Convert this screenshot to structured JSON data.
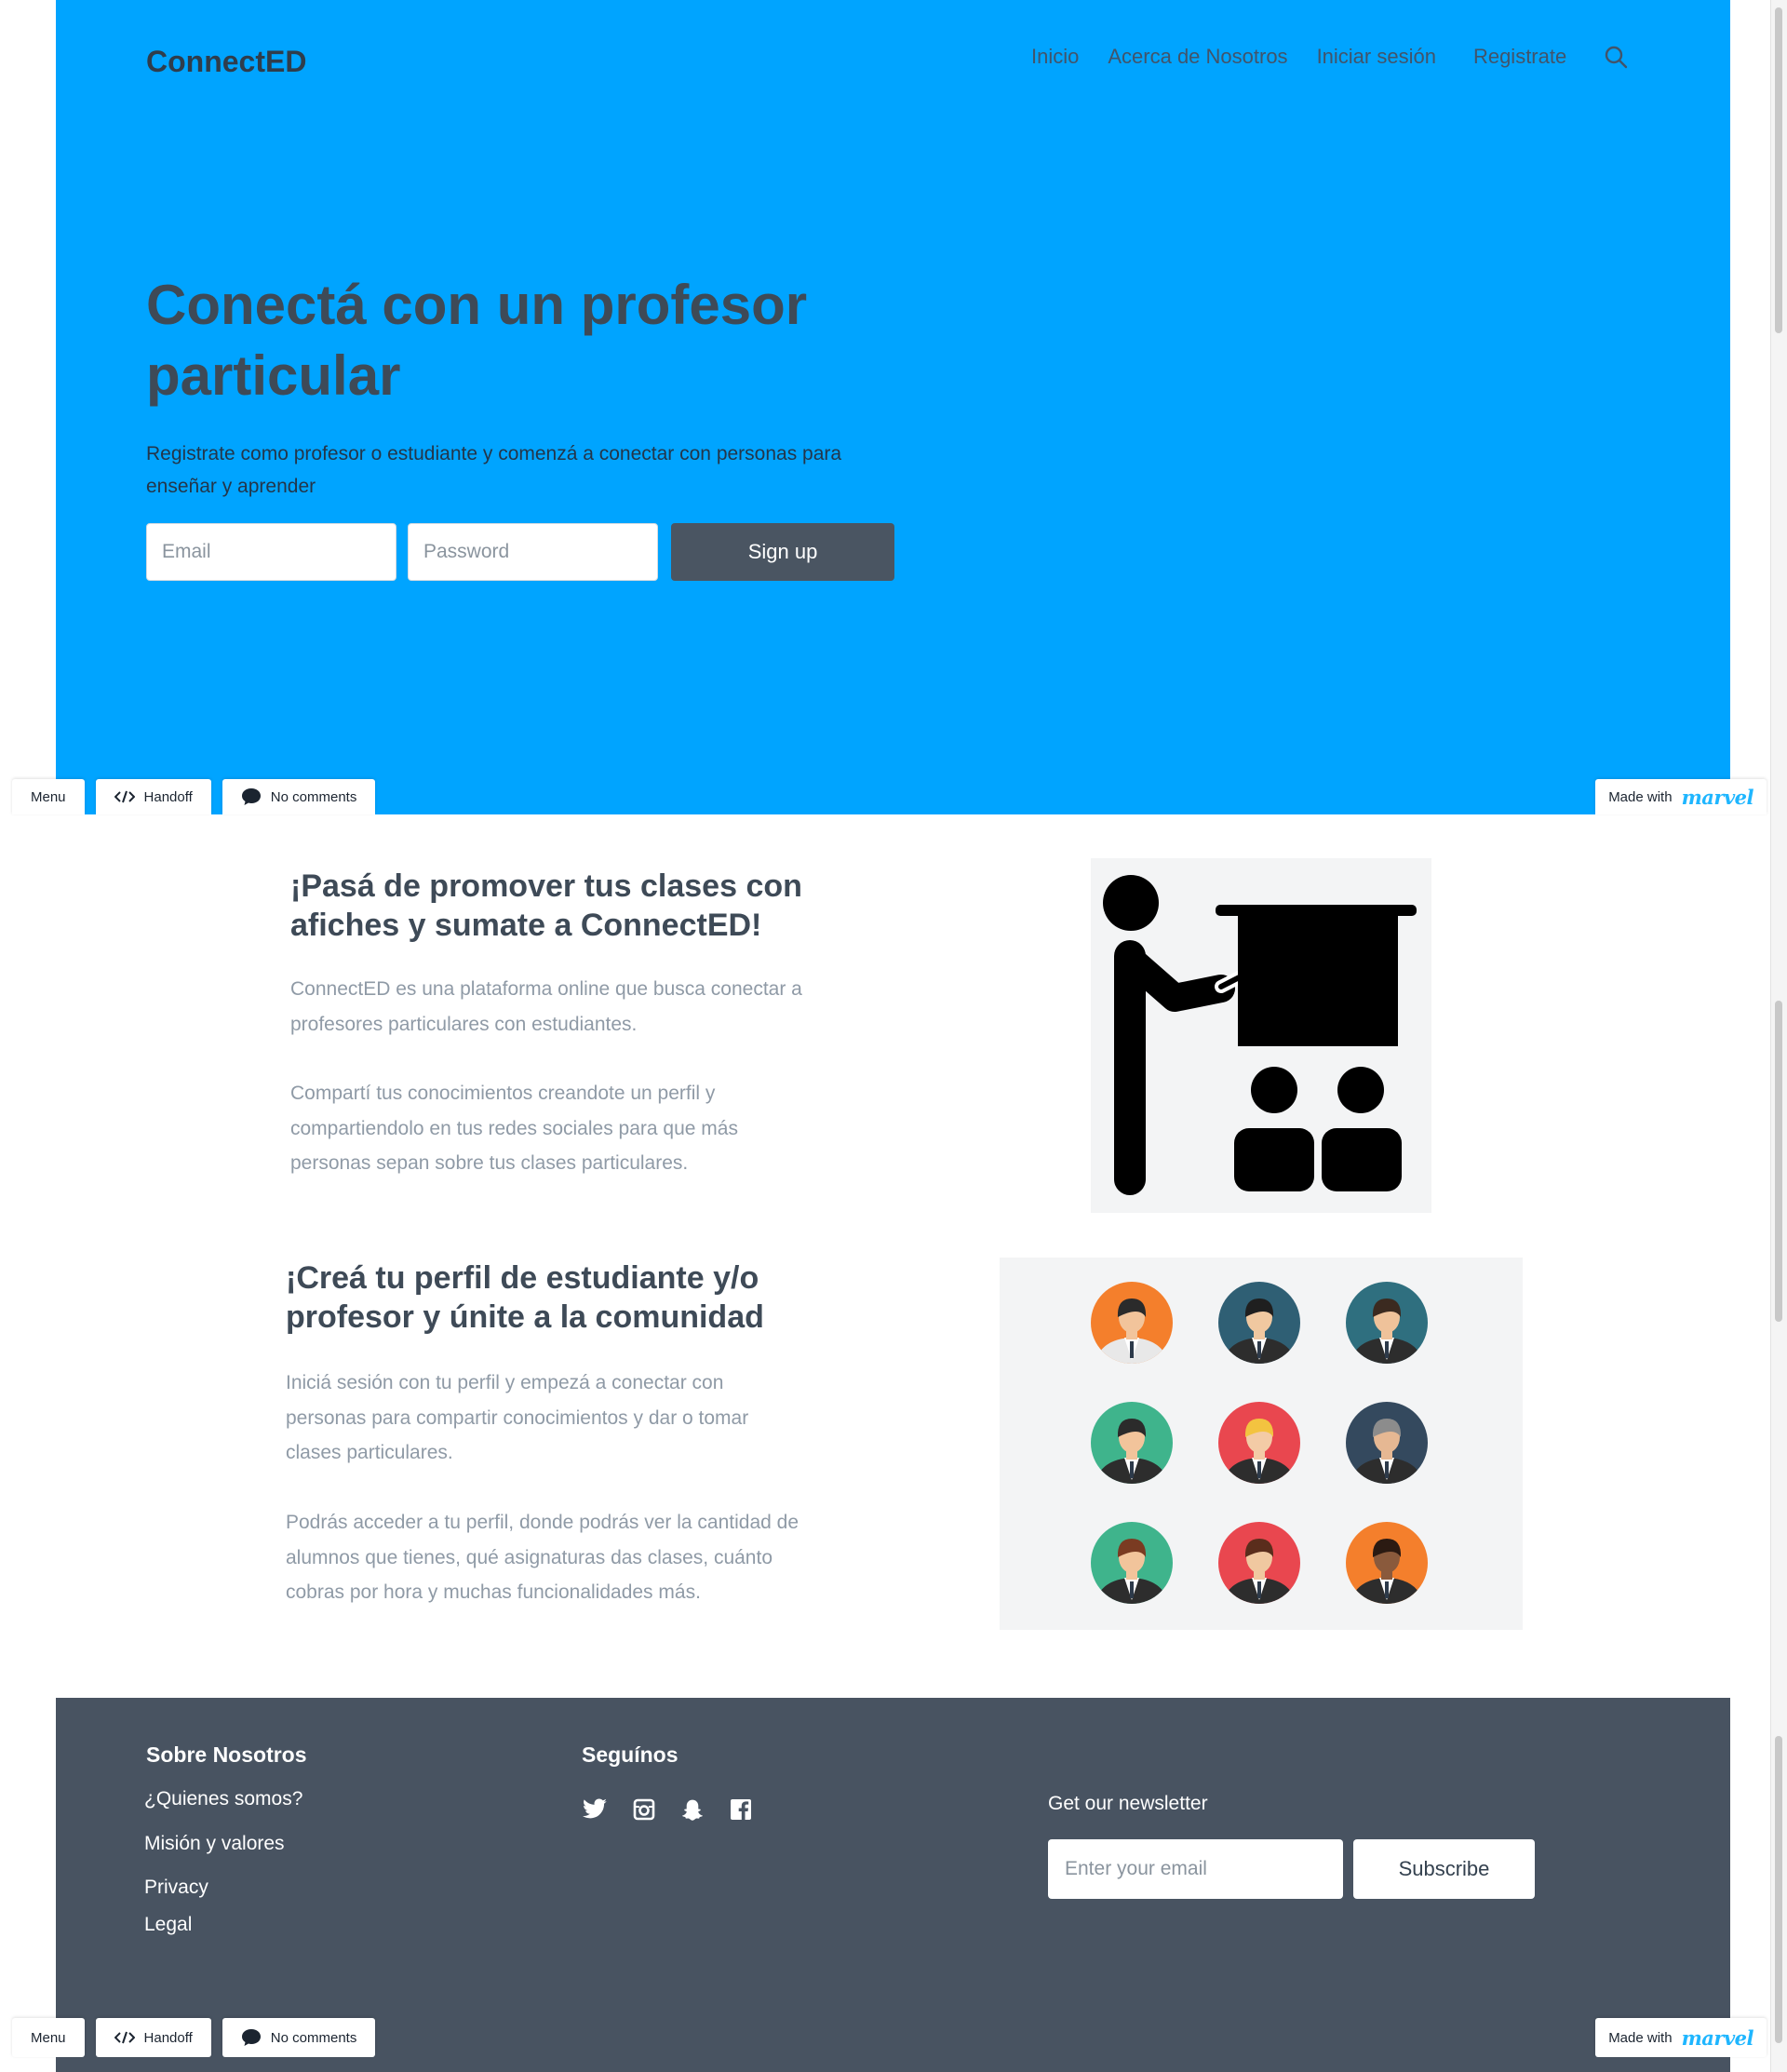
{
  "header": {
    "logo": "ConnectED",
    "nav": [
      "Inicio",
      "Acerca de Nosotros",
      "Iniciar sesión",
      "Registrate"
    ]
  },
  "hero": {
    "title": "Conectá con un profesor particular",
    "subtitle": "Registrate como profesor o estudiante y comenzá a conectar con personas para enseñar y aprender",
    "email_placeholder": "Email",
    "password_placeholder": "Password",
    "signup_label": "Sign up"
  },
  "marvel_bar": {
    "menu": "Menu",
    "handoff": "Handoff",
    "comments": "No comments",
    "made_with": "Made with",
    "brand": "marvel"
  },
  "section1": {
    "title": "¡Pasá de promover tus clases con afiches y sumate a ConnectED!",
    "p1": "ConnectED es una plataforma online que busca conectar a profesores particulares con estudiantes.",
    "p2": "Compartí tus conocimientos creandote un perfil y compartiendolo en tus redes sociales para que más personas sepan sobre tus clases particulares."
  },
  "section2": {
    "title": "¡Creá tu perfil de estudiante y/o profesor y únite a la comunidad",
    "p1": "Iniciá sesión con tu perfil y empezá a conectar con personas para compartir conocimientos y dar o tomar clases particulares.",
    "p2": "Podrás acceder a tu perfil, donde podrás ver la cantidad de alumnos que tienes, qué asignaturas das clases, cuánto cobras por hora y muchas funcionalidades más."
  },
  "avatars": {
    "bg_colors": [
      "#f47f2c",
      "#2f5f74",
      "#2f6f7f",
      "#3fb48c",
      "#e9474f",
      "#34495e",
      "#3fb48c",
      "#e9474f",
      "#f47f2c"
    ]
  },
  "footer": {
    "about_heading": "Sobre Nosotros",
    "about_links": [
      "¿Quienes somos?",
      "Misión y valores",
      "Privacy",
      "Legal"
    ],
    "follow_heading": "Seguínos",
    "social_icons": [
      "twitter-icon",
      "instagram-icon",
      "snapchat-icon",
      "facebook-icon"
    ],
    "newsletter_label": "Get our newsletter",
    "newsletter_placeholder": "Enter your email",
    "subscribe_label": "Subscribe"
  },
  "colors": {
    "hero_bg": "#00a4ff",
    "footer_bg": "#485361",
    "dark_button": "#4a5562",
    "marvel_brand": "#1fb6ff"
  }
}
